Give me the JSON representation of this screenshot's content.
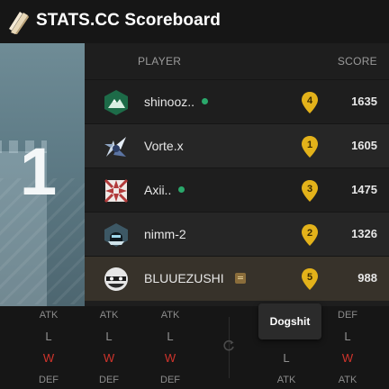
{
  "app": {
    "title": "STATS.CC Scoreboard"
  },
  "rank": {
    "value": "1"
  },
  "table": {
    "col_player": "PLAYER",
    "col_score": "SCORE",
    "rows": [
      {
        "name": "shinooz..",
        "online": true,
        "rank_pin": "4",
        "score": "1635",
        "avatar": "mountain-badge-icon"
      },
      {
        "name": "Vorte.x",
        "online": false,
        "rank_pin": "1",
        "score": "1605",
        "avatar": "winged-badge-icon"
      },
      {
        "name": "Axii..",
        "online": true,
        "rank_pin": "3",
        "score": "1475",
        "avatar": "star-cross-badge-icon"
      },
      {
        "name": "nimm-2",
        "online": false,
        "rank_pin": "2",
        "score": "1326",
        "avatar": "helmet-badge-icon"
      },
      {
        "name": "BLUUEZUSHI",
        "online": false,
        "rank_pin": "5",
        "score": "988",
        "avatar": "masked-face-badge-icon",
        "note": true
      }
    ]
  },
  "rounds": {
    "atk_label": "ATK",
    "def_label": "DEF",
    "left_cols": [
      {
        "top": "ATK",
        "r1": "L",
        "r2": "W",
        "bottom": "DEF"
      },
      {
        "top": "ATK",
        "r1": "L",
        "r2": "W",
        "bottom": "DEF"
      },
      {
        "top": "ATK",
        "r1": "L",
        "r2": "W",
        "bottom": "DEF"
      }
    ],
    "right_cols": [
      {
        "top": "",
        "r1": "",
        "r2": "L",
        "bottom": "ATK"
      },
      {
        "top": "DEF",
        "r1": "L",
        "r2": "W",
        "bottom": "ATK"
      }
    ]
  },
  "tooltip": {
    "text": "Dogshit"
  },
  "colors": {
    "accent_pin": "#e3b21a",
    "online": "#2aa86b",
    "win": "#d0342c",
    "loss": "#8f8f8f"
  }
}
